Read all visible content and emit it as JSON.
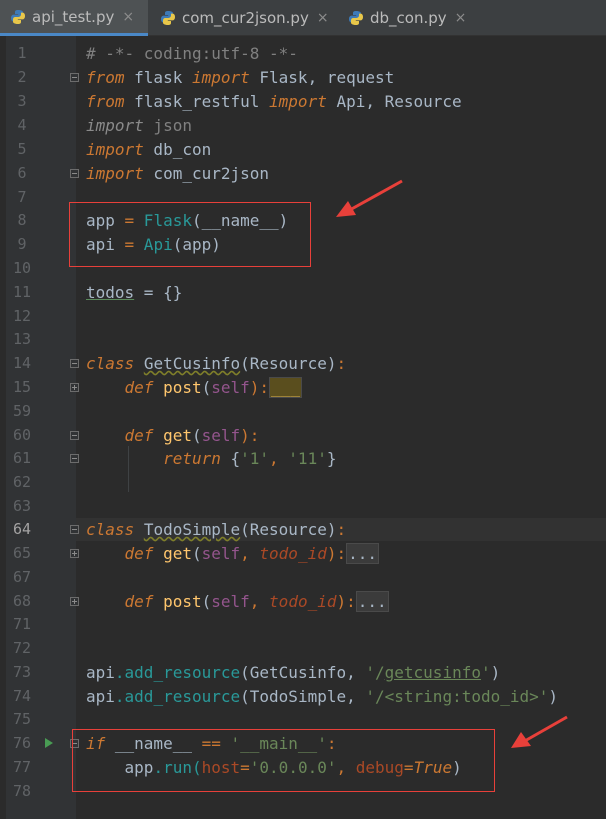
{
  "tabs": [
    {
      "label": "api_test.py",
      "active": true
    },
    {
      "label": "com_cur2json.py",
      "active": false
    },
    {
      "label": "db_con.py",
      "active": false
    }
  ],
  "close_glyph": "×",
  "line_numbers": [
    "1",
    "2",
    "3",
    "4",
    "5",
    "6",
    "7",
    "8",
    "9",
    "10",
    "11",
    "12",
    "13",
    "14",
    "15",
    "59",
    "60",
    "61",
    "62",
    "63",
    "64",
    "65",
    "67",
    "68",
    "71",
    "72",
    "73",
    "74",
    "75",
    "76",
    "77",
    "78"
  ],
  "code": {
    "l1": "# -*- coding:utf-8 -*-",
    "l2_kw1": "from",
    "l2_mod": " flask ",
    "l2_kw2": "import",
    "l2_rest": " Flask, request",
    "l3_kw1": "from",
    "l3_mod": " flask_restful ",
    "l3_kw2": "import",
    "l3_rest": " Api, Resource",
    "l4_kw": "import",
    "l4_rest": " json",
    "l5_kw": "import",
    "l5_rest": " db_con",
    "l6_kw": "import",
    "l6_rest": " com_cur2json",
    "l8_a": "app ",
    "l8_eq": "=",
    "l8_b": " Flask",
    "l8_c": "(__name__)",
    "l9_a": "api ",
    "l9_eq": "=",
    "l9_b": " Api",
    "l9_c": "(app)",
    "l11_a": "todos",
    "l11_b": " = {}",
    "l14_kw": "class",
    "l14_name": "GetCusinfo",
    "l14_rest": "(Resource)",
    "l14_colon": ":",
    "l15_kw": "def",
    "l15_fn": " post",
    "l15_p": "(",
    "l15_self": "self",
    "l15_q": "):",
    "l15_fold": "___",
    "l60_kw": "def",
    "l60_fn": " get",
    "l60_p": "(",
    "l60_self": "self",
    "l60_q": "):",
    "l61_kw": "return",
    "l61_a": " {",
    "l61_s1": "'1'",
    "l61_c": ", ",
    "l61_s2": "'11'",
    "l61_e": "}",
    "l64_kw": "class",
    "l64_name": "TodoSimple",
    "l64_rest": "(Resource)",
    "l64_colon": ":",
    "l65_kw": "def",
    "l65_fn": " get",
    "l65_p": "(",
    "l65_self": "self",
    "l65_c": ", ",
    "l65_arg": "todo_id",
    "l65_q": "):",
    "l65_fold": "...",
    "l68_kw": "def",
    "l68_fn": " post",
    "l68_p": "(",
    "l68_self": "self",
    "l68_c": ", ",
    "l68_arg": "todo_id",
    "l68_q": "):",
    "l68_fold": "...",
    "l73_a": "api",
    "l73_b": ".add_resource",
    "l73_c": "(GetCusinfo, ",
    "l73_s1": "'/",
    "l73_s2": "getcusinfo",
    "l73_s3": "'",
    "l73_d": ")",
    "l74_a": "api",
    "l74_b": ".add_resource",
    "l74_c": "(TodoSimple, ",
    "l74_s": "'/<string:todo_id>'",
    "l74_d": ")",
    "l76_kw": "if",
    "l76_a": " __name__ ",
    "l76_eq": "==",
    "l76_s": " '__main__'",
    "l76_colon": ":",
    "l77_a": "    app",
    "l77_b": ".run(",
    "l77_k1": "host",
    "l77_e1": "=",
    "l77_s": "'0.0.0.0'",
    "l77_c": ", ",
    "l77_k2": "debug",
    "l77_e2": "=",
    "l77_true": "True",
    "l77_d": ")"
  },
  "colors": {
    "annotation": "#e8403a",
    "accent": "#4a88c7"
  }
}
